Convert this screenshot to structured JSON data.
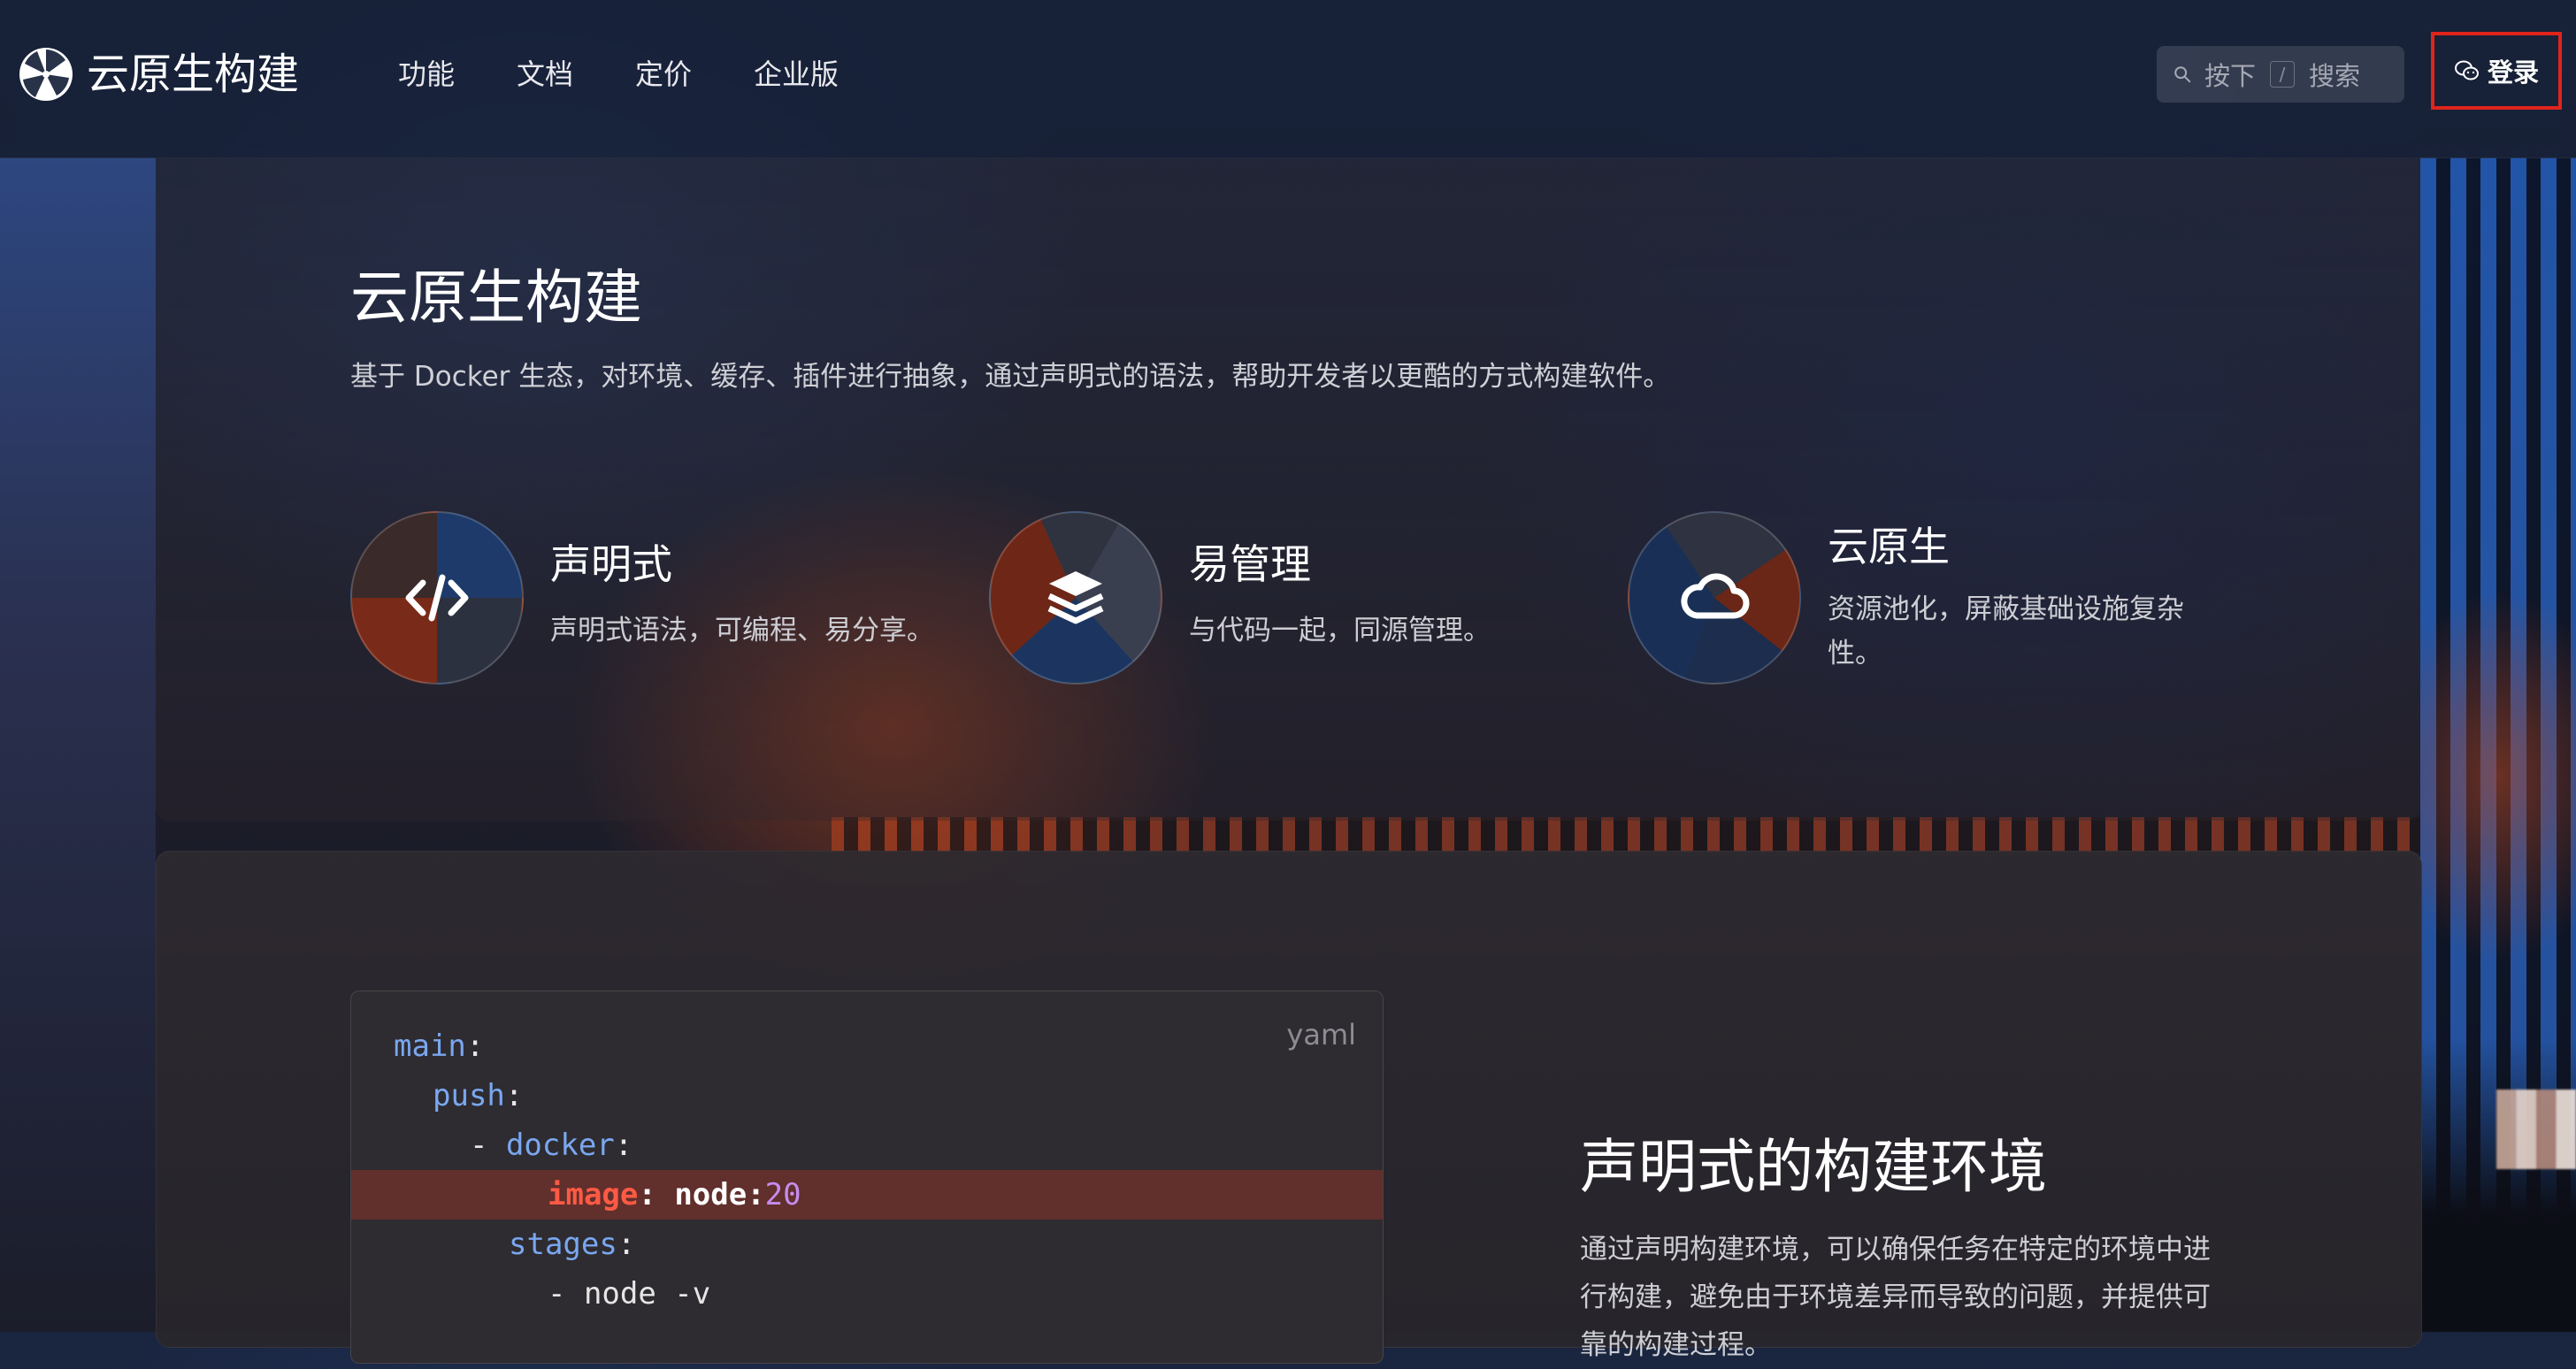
{
  "header": {
    "brand": "云原生构建",
    "nav": [
      "功能",
      "文档",
      "定价",
      "企业版"
    ],
    "search": {
      "key1": "按下",
      "slash": "/",
      "key2": "搜索"
    },
    "login_label": "登录"
  },
  "hero": {
    "title": "云原生构建",
    "subtitle": "基于 Docker 生态，对环境、缓存、插件进行抽象，通过声明式的语法，帮助开发者以更酷的方式构建软件。"
  },
  "features": [
    {
      "icon": "code-icon",
      "title": "声明式",
      "desc": "声明式语法，可编程、易分享。"
    },
    {
      "icon": "layers-icon",
      "title": "易管理",
      "desc": "与代码一起，同源管理。"
    },
    {
      "icon": "cloud-icon",
      "title": "云原生",
      "desc": "资源池化，屏蔽基础设施复杂性。"
    }
  ],
  "code_sample": {
    "language": "yaml",
    "lines": [
      {
        "indent": "",
        "key": "main",
        "rest": ":"
      },
      {
        "indent": "  ",
        "key": "push",
        "rest": ":"
      },
      {
        "indent": "    - ",
        "key": "docker",
        "rest": ":"
      },
      {
        "indent": "        ",
        "key": "image",
        "rest": ": ",
        "value": "node:",
        "num": "20",
        "highlight": true
      },
      {
        "indent": "      ",
        "key": "stages",
        "rest": ":"
      },
      {
        "indent": "        - ",
        "plain": "node -v"
      }
    ]
  },
  "section": {
    "title": "声明式的构建环境",
    "desc": "通过声明构建环境，可以确保任务在特定的环境中进行构建，避免由于环境差异而导致的问题，并提供可靠的构建过程。"
  },
  "colors": {
    "login_highlight_border": "#e0241c",
    "code_key": "#7aa7f0",
    "code_key_highlight": "#ff5a44",
    "code_number": "#c58cf0"
  }
}
